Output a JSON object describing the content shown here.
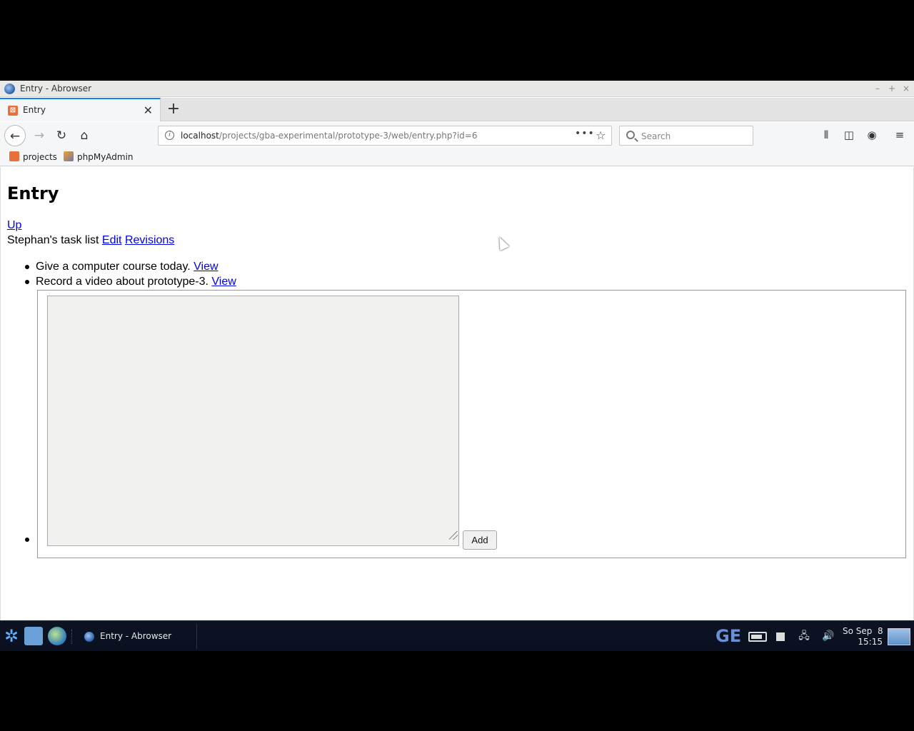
{
  "window": {
    "title": "Entry - Abrowser"
  },
  "tab": {
    "label": "Entry"
  },
  "nav": {
    "url_host": "localhost",
    "url_path": "/projects/gba-experimental/prototype-3/web/entry.php?id=6",
    "search_placeholder": "Search"
  },
  "bookmarks": [
    {
      "label": "projects"
    },
    {
      "label": "phpMyAdmin"
    }
  ],
  "page": {
    "heading": "Entry",
    "up_link": "Up",
    "list_title": "Stephan's task list",
    "edit_link": "Edit",
    "revisions_link": "Revisions",
    "tasks": [
      {
        "text": "Give a computer course today.",
        "link": "View"
      },
      {
        "text": "Record a video about prototype-3.",
        "link": "View"
      }
    ],
    "new_task_value": "",
    "add_button": "Add"
  },
  "taskbar": {
    "task_label": "Entry - Abrowser",
    "tray_ge": "GE",
    "clock_date": "So Sep  8",
    "clock_time": "15:15"
  }
}
